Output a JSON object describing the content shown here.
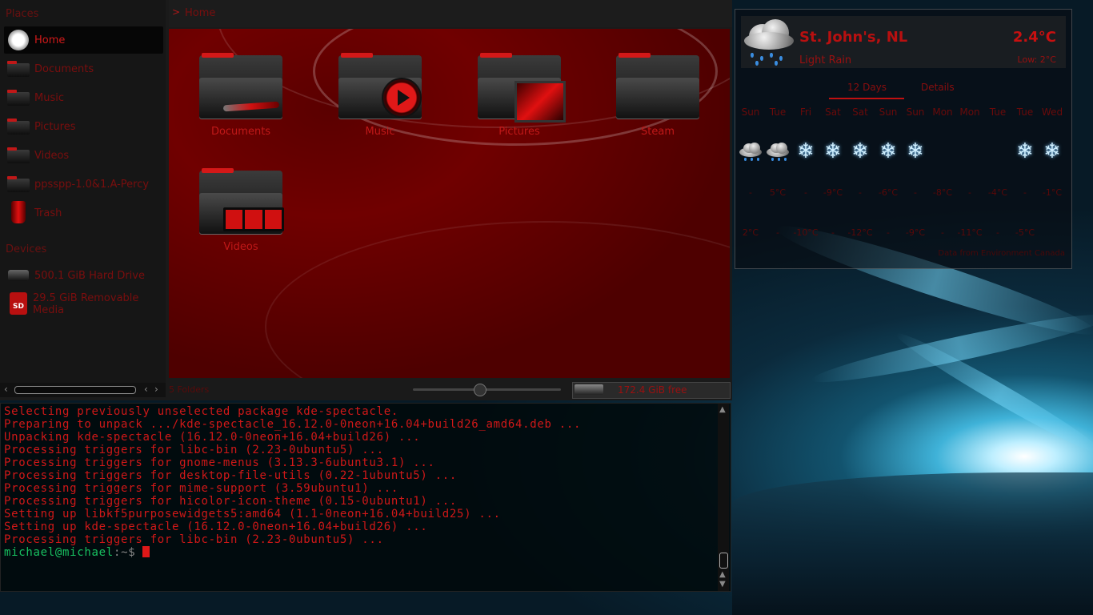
{
  "places": {
    "title": "Places",
    "items": [
      {
        "label": "Home",
        "icon": "home-icon",
        "active": true
      },
      {
        "label": "Documents",
        "icon": "folder-icon"
      },
      {
        "label": "Music",
        "icon": "folder-icon"
      },
      {
        "label": "Pictures",
        "icon": "folder-icon"
      },
      {
        "label": "Videos",
        "icon": "folder-icon"
      },
      {
        "label": "ppsspp-1.0&1.A-Percy",
        "icon": "folder-icon"
      },
      {
        "label": "Trash",
        "icon": "trash-icon"
      }
    ],
    "devices_title": "Devices",
    "devices": [
      {
        "label": "500.1 GiB Hard Drive",
        "icon": "hard-drive-icon"
      },
      {
        "label": "29.5 GiB Removable Media",
        "icon": "sd-card-icon"
      }
    ]
  },
  "breadcrumb": {
    "path": "Home"
  },
  "folders": [
    "Documents",
    "Music",
    "Pictures",
    "Steam",
    "Videos"
  ],
  "statusbar": {
    "count": "5 Folders",
    "free": "172.4 GiB free",
    "zoom_level": 0.45
  },
  "terminal": {
    "lines": [
      "Selecting previously unselected package kde-spectacle.",
      "Preparing to unpack .../kde-spectacle_16.12.0-0neon+16.04+build26_amd64.deb ...",
      "Unpacking kde-spectacle (16.12.0-0neon+16.04+build26) ...",
      "Processing triggers for libc-bin (2.23-0ubuntu5) ...",
      "Processing triggers for gnome-menus (3.13.3-6ubuntu3.1) ...",
      "Processing triggers for desktop-file-utils (0.22-1ubuntu5) ...",
      "Processing triggers for mime-support (3.59ubuntu1) ...",
      "Processing triggers for hicolor-icon-theme (0.15-0ubuntu1) ...",
      "Setting up libkf5purposewidgets5:amd64 (1.1-0neon+16.04+build25) ...",
      "Setting up kde-spectacle (16.12.0-0neon+16.04+build26) ...",
      "Processing triggers for libc-bin (2.23-0ubuntu5) ..."
    ],
    "prompt_user": "michael@michael",
    "prompt_path": ":~$"
  },
  "weather": {
    "location": "St. John's, NL",
    "condition": "Light Rain",
    "temp": "2.4°C",
    "low": "Low: 2°C",
    "tabs": [
      "12 Days",
      "Details"
    ],
    "days": [
      "Sun",
      "Tue",
      "Fri",
      "Sat",
      "Sat",
      "Sun",
      "Sun",
      "Mon",
      "Mon",
      "Tue",
      "Tue",
      "Wed"
    ],
    "icons": [
      "rain-cloud-icon",
      "rain-cloud-icon",
      "snowflake-icon",
      "snowflake-icon",
      "snowflake-icon",
      "snowflake-icon",
      "snowflake-icon",
      "",
      "",
      "",
      "snowflake-icon",
      "snowflake-icon"
    ],
    "highs": [
      "-",
      "5°C",
      "-",
      "-9°C",
      "-",
      "-6°C",
      "-",
      "-8°C",
      "-",
      "-4°C",
      "-",
      "-1°C"
    ],
    "lows": [
      "2°C",
      "-",
      "-10°C",
      "-",
      "-12°C",
      "-",
      "-9°C",
      "-",
      "-11°C",
      "-",
      "-5°C",
      ""
    ],
    "source": "Data from Environment Canada"
  },
  "colors": {
    "accent": "#c01818",
    "terminal_text": "#d01818",
    "prompt": "#18c060"
  }
}
